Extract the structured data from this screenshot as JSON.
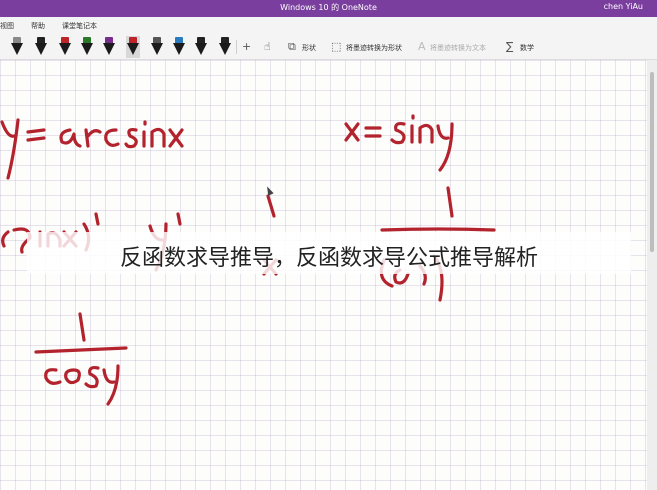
{
  "window": {
    "title": "Windows 10 的 OneNote",
    "user": "chen YiAu"
  },
  "menu": [
    "视图",
    "帮助",
    "课堂笔记本"
  ],
  "toolbar": {
    "pens": [
      {
        "cap": "#8a8a8a"
      },
      {
        "cap": "#222222"
      },
      {
        "cap": "#c0242b"
      },
      {
        "cap": "#2a7a2a"
      },
      {
        "cap": "#7a2b8e"
      },
      {
        "cap": "#c0242b"
      },
      {
        "cap": "#555555"
      },
      {
        "cap": "#2a7ac0"
      },
      {
        "cap": "#222222"
      },
      {
        "cap": "#222222"
      }
    ],
    "shape_label": "形状",
    "ink_to_shape_label": "将墨迹转换为形状",
    "ink_to_text_label": "将墨迹转换为文本",
    "math_label": "数学"
  },
  "overlay_caption": "反函数求导推导，反函数求导公式推导解析",
  "colors": {
    "titlebar": "#7a3f9e",
    "ink": "#b3232d"
  }
}
